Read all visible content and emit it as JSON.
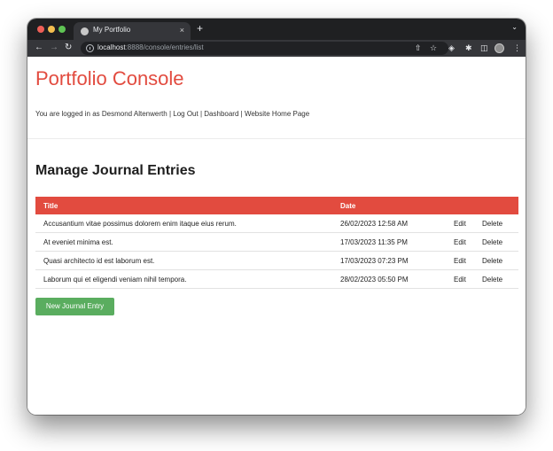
{
  "browser": {
    "tab_title": "My Portfolio",
    "tab_close": "×",
    "new_tab": "+",
    "url_host": "localhost",
    "url_rest": ":8888/console/entries/list",
    "icons": [
      "back-arrow-icon",
      "forward-arrow-icon",
      "reload-icon",
      "info-icon",
      "share-icon",
      "bookmark-star-icon",
      "extension-icon",
      "puzzle-icon",
      "side-panel-icon",
      "profile-avatar-icon",
      "kebab-menu-icon"
    ]
  },
  "page": {
    "site_title": "Portfolio Console",
    "nav": {
      "logged_in_text": "You are logged in as Desmond Altenwerth",
      "separator": "|",
      "logout": "Log Out",
      "dashboard": "Dashboard",
      "website_home": "Website Home Page"
    },
    "heading": "Manage Journal Entries",
    "table": {
      "headers": {
        "title": "Title",
        "date": "Date"
      },
      "rows": [
        {
          "title": "Accusantium vitae possimus dolorem enim itaque eius rerum.",
          "date": "26/02/2023 12:58 AM",
          "edit": "Edit",
          "delete": "Delete"
        },
        {
          "title": "At eveniet minima est.",
          "date": "17/03/2023 11:35 PM",
          "edit": "Edit",
          "delete": "Delete"
        },
        {
          "title": "Quasi architecto id est laborum est.",
          "date": "17/03/2023 07:23 PM",
          "edit": "Edit",
          "delete": "Delete"
        },
        {
          "title": "Laborum qui et eligendi veniam nihil tempora.",
          "date": "28/02/2023 05:50 PM",
          "edit": "Edit",
          "delete": "Delete"
        }
      ]
    },
    "new_entry_button": "New Journal Entry"
  },
  "colors": {
    "accent": "#e24b3f",
    "button_green": "#5aad5f",
    "browser_frame": "#35363a"
  }
}
